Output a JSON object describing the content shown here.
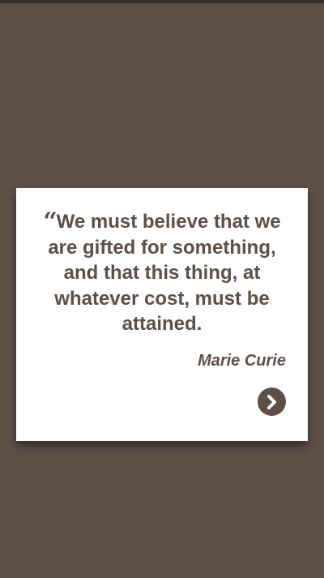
{
  "quote": {
    "mark_icon": "quote-open-icon",
    "mark_glyph": "“",
    "text": "We must believe that we are gifted for something, and that this thing, at whatever cost, must be attained.",
    "author": "Marie Curie"
  },
  "controls": {
    "next_icon": "chevron-right-icon"
  },
  "colors": {
    "background": "#5e4f47",
    "card": "#ffffff",
    "text": "#5e4f47",
    "status_bar": "#2f2f2f"
  }
}
